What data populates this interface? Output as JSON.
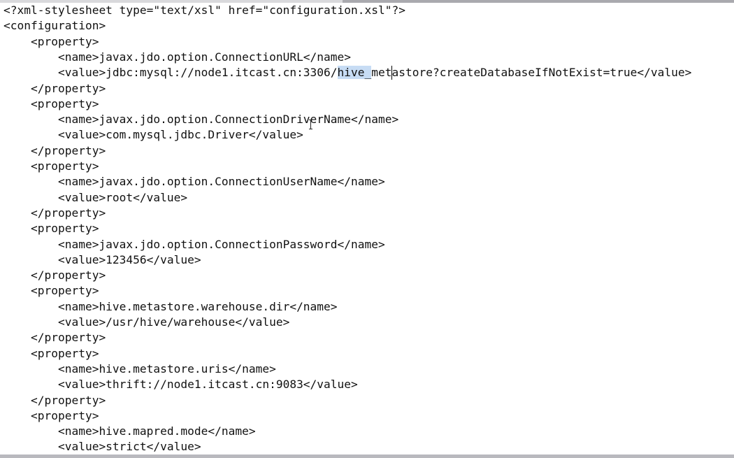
{
  "editor": {
    "lines": [
      "<?xml-stylesheet type=\"text/xsl\" href=\"configuration.xsl\"?>",
      "<configuration>",
      "    <property>",
      "        <name>javax.jdo.option.ConnectionURL</name>",
      {
        "before": "        <value>jdbc:mysql://node1.itcast.cn:3306/",
        "selected": "hive_",
        "after": "metastore?createDatabaseIfNotExist=true</value>"
      },
      "    </property>",
      "    <property>",
      "        <name>javax.jdo.option.ConnectionDriverName</name>",
      "        <value>com.mysql.jdbc.Driver</value>",
      "    </property>",
      "    <property>",
      "        <name>javax.jdo.option.ConnectionUserName</name>",
      "        <value>root</value>",
      "    </property>",
      "    <property>",
      "        <name>javax.jdo.option.ConnectionPassword</name>",
      "        <value>123456</value>",
      "    </property>",
      "    <property>",
      "        <name>hive.metastore.warehouse.dir</name>",
      "        <value>/usr/hive/warehouse</value>",
      "    </property>",
      "    <property>",
      "        <name>hive.metastore.uris</name>",
      "        <value>thrift://node1.itcast.cn:9083</value>",
      "    </property>",
      "    <property>",
      "        <name>hive.mapred.mode</name>",
      "        <value>strict</value>"
    ]
  },
  "colors": {
    "text": "#111111",
    "selection": "#c7dcf4",
    "background": "#ffffff",
    "scrollbar": "#a9a9ae"
  },
  "icons": {
    "mouse_cursor": "i-beam-cursor-icon"
  }
}
